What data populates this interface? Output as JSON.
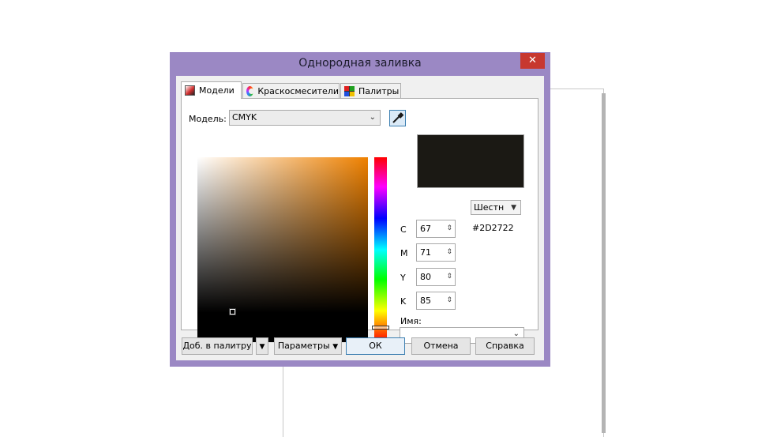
{
  "dialog": {
    "title": "Однородная заливка",
    "close_glyph": "✕"
  },
  "tabs": [
    {
      "label": "Модели",
      "icon": "color-models-icon",
      "active": true
    },
    {
      "label": "Краскосмесители",
      "icon": "color-mixer-icon",
      "active": false
    },
    {
      "label": "Палитры",
      "icon": "palette-icon",
      "active": false
    }
  ],
  "model": {
    "label": "Модель:",
    "value": "CMYK"
  },
  "colors": {
    "swatch": "#1B1914",
    "accent": "#9B88C4",
    "close": "#C7372F"
  },
  "format_select": {
    "value": "Шестн"
  },
  "hex_value": "#2D2722",
  "channels": [
    {
      "label": "C",
      "value": "67"
    },
    {
      "label": "M",
      "value": "71"
    },
    {
      "label": "Y",
      "value": "80"
    },
    {
      "label": "K",
      "value": "85"
    }
  ],
  "name_field": {
    "label": "Имя:",
    "value": ""
  },
  "buttons": {
    "add_to_palette": "Доб. в палитру",
    "options": "Параметры",
    "ok": "ОК",
    "cancel": "Отмена",
    "help": "Справка"
  }
}
